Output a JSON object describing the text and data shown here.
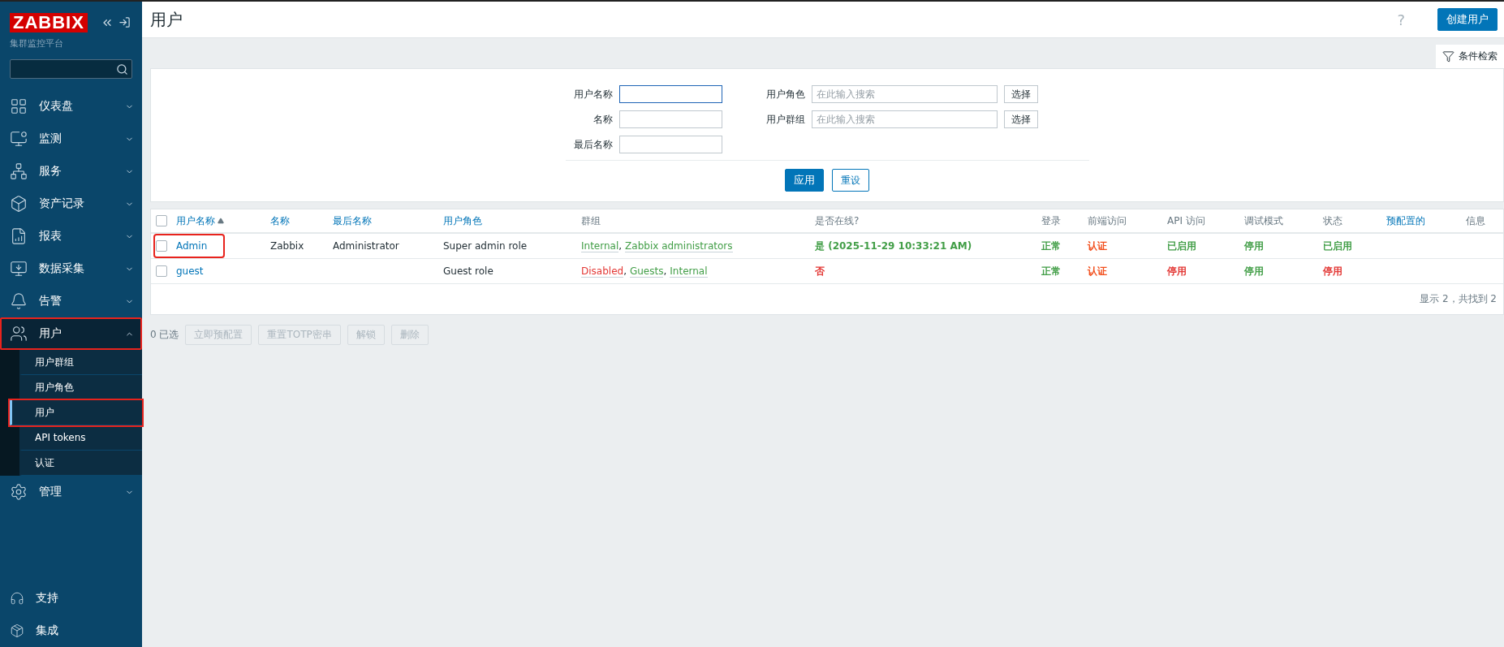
{
  "sidebar": {
    "logo": "ZABBIX",
    "subtitle": "集群监控平台",
    "items": [
      {
        "kind": "dashboard",
        "label": "仪表盘",
        "expanded": false,
        "selected": false,
        "highlighted": false
      },
      {
        "kind": "monitor",
        "label": "监测",
        "expanded": false,
        "selected": false,
        "highlighted": false
      },
      {
        "kind": "services",
        "label": "服务",
        "expanded": false,
        "selected": false,
        "highlighted": false
      },
      {
        "kind": "inventory",
        "label": "资产记录",
        "expanded": false,
        "selected": false,
        "highlighted": false
      },
      {
        "kind": "reports",
        "label": "报表",
        "expanded": false,
        "selected": false,
        "highlighted": false
      },
      {
        "kind": "collect",
        "label": "数据采集",
        "expanded": false,
        "selected": false,
        "highlighted": false
      },
      {
        "kind": "alerts",
        "label": "告警",
        "expanded": false,
        "selected": false,
        "highlighted": false
      },
      {
        "kind": "users",
        "label": "用户",
        "expanded": true,
        "selected": true,
        "highlighted": true,
        "children": [
          {
            "label": "用户群组",
            "selected": false,
            "highlighted": false
          },
          {
            "label": "用户角色",
            "selected": false,
            "highlighted": false
          },
          {
            "label": "用户",
            "selected": true,
            "highlighted": true
          },
          {
            "label": "API tokens",
            "selected": false,
            "highlighted": false
          },
          {
            "label": "认证",
            "selected": false,
            "highlighted": false
          }
        ]
      },
      {
        "kind": "admin",
        "label": "管理",
        "expanded": false,
        "selected": false,
        "highlighted": false
      }
    ],
    "bottom_items": [
      {
        "kind": "support",
        "label": "支持"
      },
      {
        "kind": "integrations",
        "label": "集成"
      }
    ]
  },
  "header": {
    "title": "用户",
    "help": "?",
    "create_button": "创建用户"
  },
  "filter": {
    "tab": "条件检索",
    "fields": [
      {
        "label": "用户名称",
        "focused": true
      },
      {
        "label": "名称",
        "focused": false
      },
      {
        "label": "最后名称",
        "focused": false
      }
    ],
    "multiselects": [
      {
        "label": "用户角色",
        "placeholder": "在此输入搜索",
        "button": "选择"
      },
      {
        "label": "用户群组",
        "placeholder": "在此输入搜索",
        "button": "选择"
      }
    ],
    "apply": "应用",
    "reset": "重设"
  },
  "table": {
    "columns": [
      {
        "label": "用户名称",
        "kind": "link",
        "sorted": true
      },
      {
        "label": "名称",
        "kind": "link",
        "sorted": false
      },
      {
        "label": "最后名称",
        "kind": "link",
        "sorted": false
      },
      {
        "label": "用户角色",
        "kind": "link",
        "sorted": false
      },
      {
        "label": "群组",
        "kind": "plain",
        "sorted": false
      },
      {
        "label": "是否在线?",
        "kind": "plain",
        "sorted": false
      },
      {
        "label": "登录",
        "kind": "plain",
        "sorted": false
      },
      {
        "label": "前端访问",
        "kind": "plain",
        "sorted": false
      },
      {
        "label": "API 访问",
        "kind": "plain",
        "sorted": false
      },
      {
        "label": "调试模式",
        "kind": "plain",
        "sorted": false
      },
      {
        "label": "状态",
        "kind": "plain",
        "sorted": false
      },
      {
        "label": "预配置的",
        "kind": "link",
        "sorted": false
      },
      {
        "label": "信息",
        "kind": "plain",
        "sorted": false
      }
    ],
    "select_all_checked": false,
    "rows": [
      {
        "checked": false,
        "highlighted": true,
        "username": "Admin",
        "name": "Zabbix",
        "surname": "Administrator",
        "role": "Super admin role",
        "groups": [
          {
            "name": "Internal",
            "color": "#429e47",
            "separator": ","
          },
          {
            "name": "Zabbix administrators",
            "color": "#429e47"
          }
        ],
        "statuses": [
          {
            "text": "是 (2025-11-29 10:33:21 AM)",
            "color": "#429e47"
          },
          {
            "text": "正常",
            "color": "#429e47"
          },
          {
            "text": "认证",
            "color": "#f24f1d"
          },
          {
            "text": "已启用",
            "color": "#429e47"
          },
          {
            "text": "停用",
            "color": "#429e47"
          },
          {
            "text": "已启用",
            "color": "#429e47"
          }
        ]
      },
      {
        "checked": false,
        "highlighted": false,
        "username": "guest",
        "role": "Guest role",
        "groups": [
          {
            "name": "Disabled",
            "color": "#e33734",
            "separator": ","
          },
          {
            "name": "Guests",
            "color": "#429e47",
            "separator": ","
          },
          {
            "name": "Internal",
            "color": "#429e47"
          }
        ],
        "statuses": [
          {
            "text": "否",
            "color": "#e33734"
          },
          {
            "text": "正常",
            "color": "#429e47"
          },
          {
            "text": "认证",
            "color": "#f24f1d"
          },
          {
            "text": "停用",
            "color": "#e33734"
          },
          {
            "text": "停用",
            "color": "#429e47"
          },
          {
            "text": "停用",
            "color": "#e33734"
          }
        ]
      }
    ],
    "footer": "显示 2，共找到 2"
  },
  "actions": {
    "selected_count": "0 已选",
    "buttons": [
      {
        "label": "立即预配置",
        "disabled": true
      },
      {
        "label": "重置TOTP密串",
        "disabled": true
      },
      {
        "label": "解锁",
        "disabled": true
      },
      {
        "label": "删除",
        "disabled": true
      }
    ]
  }
}
